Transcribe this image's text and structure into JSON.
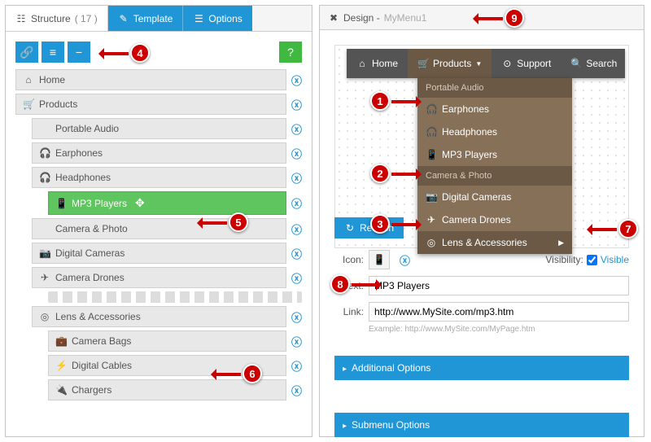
{
  "tabs": {
    "structure": "Structure",
    "count": "( 17 )",
    "template": "Template",
    "options": "Options"
  },
  "design": {
    "label": "Design -",
    "name": "MyMenu1"
  },
  "tree": [
    {
      "lvl": 0,
      "icon": "⌂",
      "label": "Home"
    },
    {
      "lvl": 0,
      "icon": "🛒",
      "label": "Products"
    },
    {
      "lvl": 1,
      "icon": "",
      "label": "Portable Audio"
    },
    {
      "lvl": 1,
      "icon": "🎧",
      "label": "Earphones"
    },
    {
      "lvl": 1,
      "icon": "🎧",
      "label": "Headphones"
    },
    {
      "lvl": 2,
      "icon": "📱",
      "label": "MP3 Players",
      "sel": true
    },
    {
      "lvl": 1,
      "icon": "",
      "label": "Camera & Photo"
    },
    {
      "lvl": 1,
      "icon": "📷",
      "label": "Digital Cameras"
    },
    {
      "lvl": 1,
      "icon": "✈",
      "label": "Camera Drones"
    },
    {
      "lvl": 1,
      "icon": "◎",
      "label": "Lens & Accessories",
      "gapBefore": true
    },
    {
      "lvl": 2,
      "icon": "💼",
      "label": "Camera Bags"
    },
    {
      "lvl": 2,
      "icon": "⚡",
      "label": "Digital Cables"
    },
    {
      "lvl": 2,
      "icon": "🔌",
      "label": "Chargers"
    }
  ],
  "menubar": [
    {
      "icon": "⌂",
      "label": "Home"
    },
    {
      "icon": "🛒",
      "label": "Products",
      "open": true
    },
    {
      "icon": "⊙",
      "label": "Support"
    },
    {
      "icon": "🔍",
      "label": "Search"
    }
  ],
  "dropdown": [
    {
      "hdr": true,
      "label": "Portable Audio"
    },
    {
      "icon": "🎧",
      "label": "Earphones"
    },
    {
      "icon": "🎧",
      "label": "Headphones"
    },
    {
      "icon": "📱",
      "label": "MP3 Players"
    },
    {
      "hdr": true,
      "label": "Camera & Photo"
    },
    {
      "icon": "📷",
      "label": "Digital Cameras"
    },
    {
      "icon": "✈",
      "label": "Camera Drones"
    },
    {
      "icon": "◎",
      "label": "Lens & Accessories",
      "hover": true,
      "sub": true
    }
  ],
  "refresh": "Refresh",
  "form": {
    "iconLabel": "Icon:",
    "textLabel": "Text:",
    "textVal": "MP3 Players",
    "linkLabel": "Link:",
    "linkVal": "http://www.MySite.com/mp3.htm",
    "hint": "Example: http://www.MySite.com/MyPage.htm",
    "visLabel": "Visibility:",
    "visLink": "Visible"
  },
  "acc": {
    "a": "Additional Options",
    "b": "Submenu Options"
  },
  "callouts": {
    "1": "1",
    "2": "2",
    "3": "3",
    "4": "4",
    "5": "5",
    "6": "6",
    "7": "7",
    "8": "8",
    "9": "9"
  }
}
